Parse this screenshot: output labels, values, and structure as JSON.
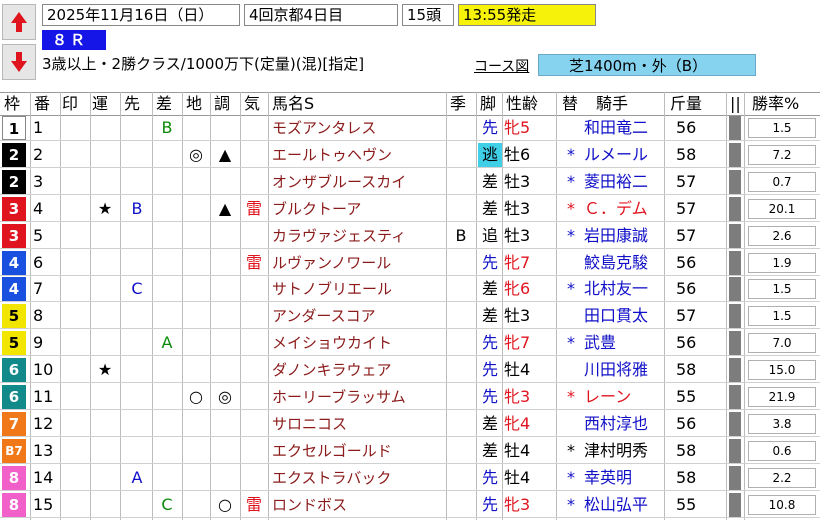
{
  "header": {
    "date": "2025年11月16日（日）",
    "meeting": "4回京都4日目",
    "runners": "15頭",
    "post_time": "13:55発走",
    "race_number": "８Ｒ",
    "conditions": "3歳以上・2勝クラス/1000万下(定量)(混)[指定]",
    "course_link": "コース図",
    "course": "芝1400m・外（B）"
  },
  "columns": {
    "waku": "枠",
    "ban": "番",
    "in": "印",
    "un": "運",
    "saki": "先",
    "sa": "差",
    "chi": "地",
    "cho": "調",
    "ki": "気",
    "name": "馬名S",
    "ki2": "季",
    "kyaku": "脚",
    "seirei": "性齢",
    "kae": "替",
    "kishu": "騎手",
    "kinryo": "斤量",
    "bar": "||",
    "win_rate": "勝率%"
  },
  "colors": {
    "waku_1": "#ffffff",
    "waku_2": "#000000",
    "waku_3": "#e0141e",
    "waku_4": "#1a50e0",
    "waku_5": "#f2e600",
    "waku_6": "#138a8a",
    "waku_7": "#f07818",
    "waku_8": "#f060c8",
    "post_time_bg": "#f7f20a",
    "course_bg": "#86d3f0",
    "race_no_bg": "#1515e8"
  },
  "rows": [
    {
      "waku": "1",
      "ban": "1",
      "in": "",
      "un": "",
      "saki": "",
      "sa": "B",
      "chi": "",
      "cho": "",
      "ki": "",
      "name": "モズアンタレス",
      "ki2": "",
      "kyaku": "先",
      "sex": "牝",
      "age": "5",
      "kae": "",
      "jockey": "和田竜二",
      "kin": "56",
      "rate": "1.5"
    },
    {
      "waku": "2",
      "ban": "2",
      "in": "",
      "un": "",
      "saki": "",
      "sa": "",
      "chi": "◎",
      "cho": "▲",
      "ki": "",
      "name": "エールトゥヘヴン",
      "ki2": "",
      "kyaku": "逃",
      "sex": "牡",
      "age": "6",
      "kae": "*",
      "jockey": "ルメール",
      "kin": "58",
      "rate": "7.2",
      "nige": true
    },
    {
      "waku": "2",
      "ban": "3",
      "in": "",
      "un": "",
      "saki": "",
      "sa": "",
      "chi": "",
      "cho": "",
      "ki": "",
      "name": "オンザブルースカイ",
      "ki2": "",
      "kyaku": "差",
      "sex": "牡",
      "age": "3",
      "kae": "*",
      "jockey": "菱田裕二",
      "kin": "57",
      "rate": "0.7"
    },
    {
      "waku": "3",
      "ban": "4",
      "in": "",
      "un": "★",
      "saki": "B",
      "sa": "",
      "chi": "",
      "cho": "▲",
      "ki": "雷",
      "name": "ブルクトーア",
      "ki2": "",
      "kyaku": "差",
      "sex": "牡",
      "age": "3",
      "kae": "*",
      "jockey": "Ｃ．デム",
      "kin": "57",
      "rate": "20.1",
      "red_jockey": true
    },
    {
      "waku": "3",
      "ban": "5",
      "in": "",
      "un": "",
      "saki": "",
      "sa": "",
      "chi": "",
      "cho": "",
      "ki": "",
      "name": "カラヴァジェスティ",
      "ki2": "B",
      "kyaku": "追",
      "sex": "牡",
      "age": "3",
      "kae": "*",
      "jockey": "岩田康誠",
      "kin": "57",
      "rate": "2.6"
    },
    {
      "waku": "4",
      "ban": "6",
      "in": "",
      "un": "",
      "saki": "",
      "sa": "",
      "chi": "",
      "cho": "",
      "ki": "雷",
      "name": "ルヴァンノワール",
      "ki2": "",
      "kyaku": "先",
      "sex": "牝",
      "age": "7",
      "kae": "",
      "jockey": "鮫島克駿",
      "kin": "56",
      "rate": "1.9"
    },
    {
      "waku": "4",
      "ban": "7",
      "in": "",
      "un": "",
      "saki": "C",
      "sa": "",
      "chi": "",
      "cho": "",
      "ki": "",
      "name": "サトノブリエール",
      "ki2": "",
      "kyaku": "差",
      "sex": "牝",
      "age": "6",
      "kae": "*",
      "jockey": "北村友一",
      "kin": "56",
      "rate": "1.5"
    },
    {
      "waku": "5",
      "ban": "8",
      "in": "",
      "un": "",
      "saki": "",
      "sa": "",
      "chi": "",
      "cho": "",
      "ki": "",
      "name": "アンダースコア",
      "ki2": "",
      "kyaku": "差",
      "sex": "牡",
      "age": "3",
      "kae": "",
      "jockey": "田口貫太",
      "kin": "57",
      "rate": "1.5"
    },
    {
      "waku": "5",
      "ban": "9",
      "in": "",
      "un": "",
      "saki": "",
      "sa": "A",
      "chi": "",
      "cho": "",
      "ki": "",
      "name": "メイショウカイト",
      "ki2": "",
      "kyaku": "先",
      "sex": "牝",
      "age": "7",
      "kae": "*",
      "jockey": "武豊",
      "kin": "56",
      "rate": "7.0"
    },
    {
      "waku": "6",
      "ban": "10",
      "in": "",
      "un": "★",
      "saki": "",
      "sa": "",
      "chi": "",
      "cho": "",
      "ki": "",
      "name": "ダノンキラウェア",
      "ki2": "",
      "kyaku": "先",
      "sex": "牡",
      "age": "4",
      "kae": "",
      "jockey": "川田将雅",
      "kin": "58",
      "rate": "15.0"
    },
    {
      "waku": "6",
      "ban": "11",
      "in": "",
      "un": "",
      "saki": "",
      "sa": "",
      "chi": "○",
      "cho": "◎",
      "ki": "",
      "name": "ホーリーブラッサム",
      "ki2": "",
      "kyaku": "先",
      "sex": "牝",
      "age": "3",
      "kae": "*",
      "jockey": "レーン",
      "kin": "55",
      "rate": "21.9",
      "red_jockey": true
    },
    {
      "waku": "7",
      "ban": "12",
      "in": "",
      "un": "",
      "saki": "",
      "sa": "",
      "chi": "",
      "cho": "",
      "ki": "",
      "name": "サロニコス",
      "ki2": "",
      "kyaku": "差",
      "sex": "牝",
      "age": "4",
      "kae": "",
      "jockey": "西村淳也",
      "kin": "56",
      "rate": "3.8"
    },
    {
      "waku": "B7",
      "ban": "13",
      "in": "",
      "un": "",
      "saki": "",
      "sa": "",
      "chi": "",
      "cho": "",
      "ki": "",
      "name": "エクセルゴールド",
      "ki2": "",
      "kyaku": "差",
      "sex": "牡",
      "age": "4",
      "kae": "*",
      "jockey": "津村明秀",
      "kin": "58",
      "rate": "0.6",
      "black_jockey": true
    },
    {
      "waku": "8",
      "ban": "14",
      "in": "",
      "un": "",
      "saki": "A",
      "sa": "",
      "chi": "",
      "cho": "",
      "ki": "",
      "name": "エクストラバック",
      "ki2": "",
      "kyaku": "先",
      "sex": "牡",
      "age": "4",
      "kae": "*",
      "jockey": "幸英明",
      "kin": "58",
      "rate": "2.2"
    },
    {
      "waku": "8",
      "ban": "15",
      "in": "",
      "un": "",
      "saki": "",
      "sa": "C",
      "chi": "",
      "cho": "○",
      "ki": "雷",
      "name": "ロンドボス",
      "ki2": "",
      "kyaku": "先",
      "sex": "牝",
      "age": "3",
      "kae": "*",
      "jockey": "松山弘平",
      "kin": "55",
      "rate": "10.8"
    }
  ]
}
